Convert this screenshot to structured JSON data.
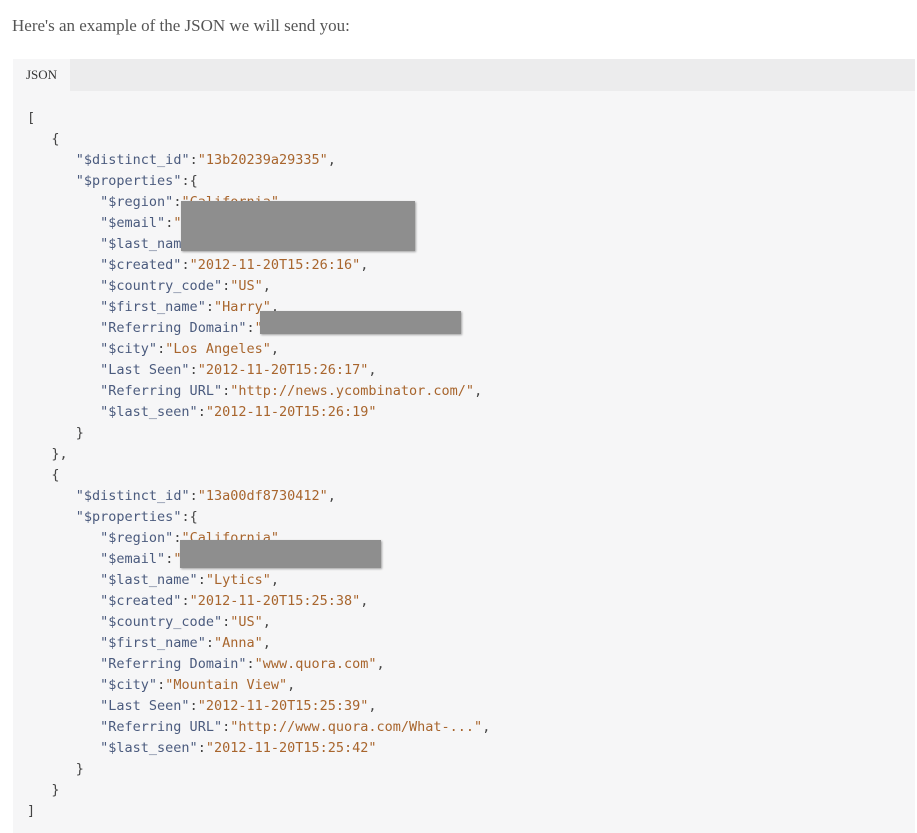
{
  "intro_text": "Here's an example of the JSON we will send you:",
  "tab_label": "JSON",
  "records": [
    {
      "distinct_id_key": "\"$distinct_id\"",
      "distinct_id_value": "\"13b20239a29335\"",
      "properties_key": "\"$properties\"",
      "props": [
        {
          "key": "\"$region\"",
          "value": "\"California\"",
          "redacted": true
        },
        {
          "key": "\"$email\"",
          "value": "\"",
          "redacted": true
        },
        {
          "key": "\"$last_nam",
          "value": "",
          "redacted": true
        },
        {
          "key": "\"$created\"",
          "value": "\"2012-11-20T15:26:16\""
        },
        {
          "key": "\"$country_code\"",
          "value": "\"US\""
        },
        {
          "key": "\"$first_name\"",
          "value": "\"Harry\"",
          "redacted": true
        },
        {
          "key": "\"Referring Domain\"",
          "value": "\"",
          "redacted": true
        },
        {
          "key": "\"$city\"",
          "value": "\"Los Angeles\""
        },
        {
          "key": "\"Last Seen\"",
          "value": "\"2012-11-20T15:26:17\""
        },
        {
          "key": "\"Referring URL\"",
          "value": "\"http://news.ycombinator.com/\""
        },
        {
          "key": "\"$last_seen\"",
          "value": "\"2012-11-20T15:26:19\"",
          "last": true
        }
      ]
    },
    {
      "distinct_id_key": "\"$distinct_id\"",
      "distinct_id_value": "\"13a00df8730412\"",
      "properties_key": "\"$properties\"",
      "props": [
        {
          "key": "\"$region\"",
          "value": "\"California\"",
          "redacted": true
        },
        {
          "key": "\"$email\"",
          "value": "\"",
          "redacted": true
        },
        {
          "key": "\"$last_name\"",
          "value": "\"Lytics\""
        },
        {
          "key": "\"$created\"",
          "value": "\"2012-11-20T15:25:38\""
        },
        {
          "key": "\"$country_code\"",
          "value": "\"US\""
        },
        {
          "key": "\"$first_name\"",
          "value": "\"Anna\""
        },
        {
          "key": "\"Referring Domain\"",
          "value": "\"www.quora.com\""
        },
        {
          "key": "\"$city\"",
          "value": "\"Mountain View\""
        },
        {
          "key": "\"Last Seen\"",
          "value": "\"2012-11-20T15:25:39\""
        },
        {
          "key": "\"Referring URL\"",
          "value": "\"http://www.quora.com/What-...\""
        },
        {
          "key": "\"$last_seen\"",
          "value": "\"2012-11-20T15:25:42\"",
          "last": true
        }
      ]
    }
  ]
}
